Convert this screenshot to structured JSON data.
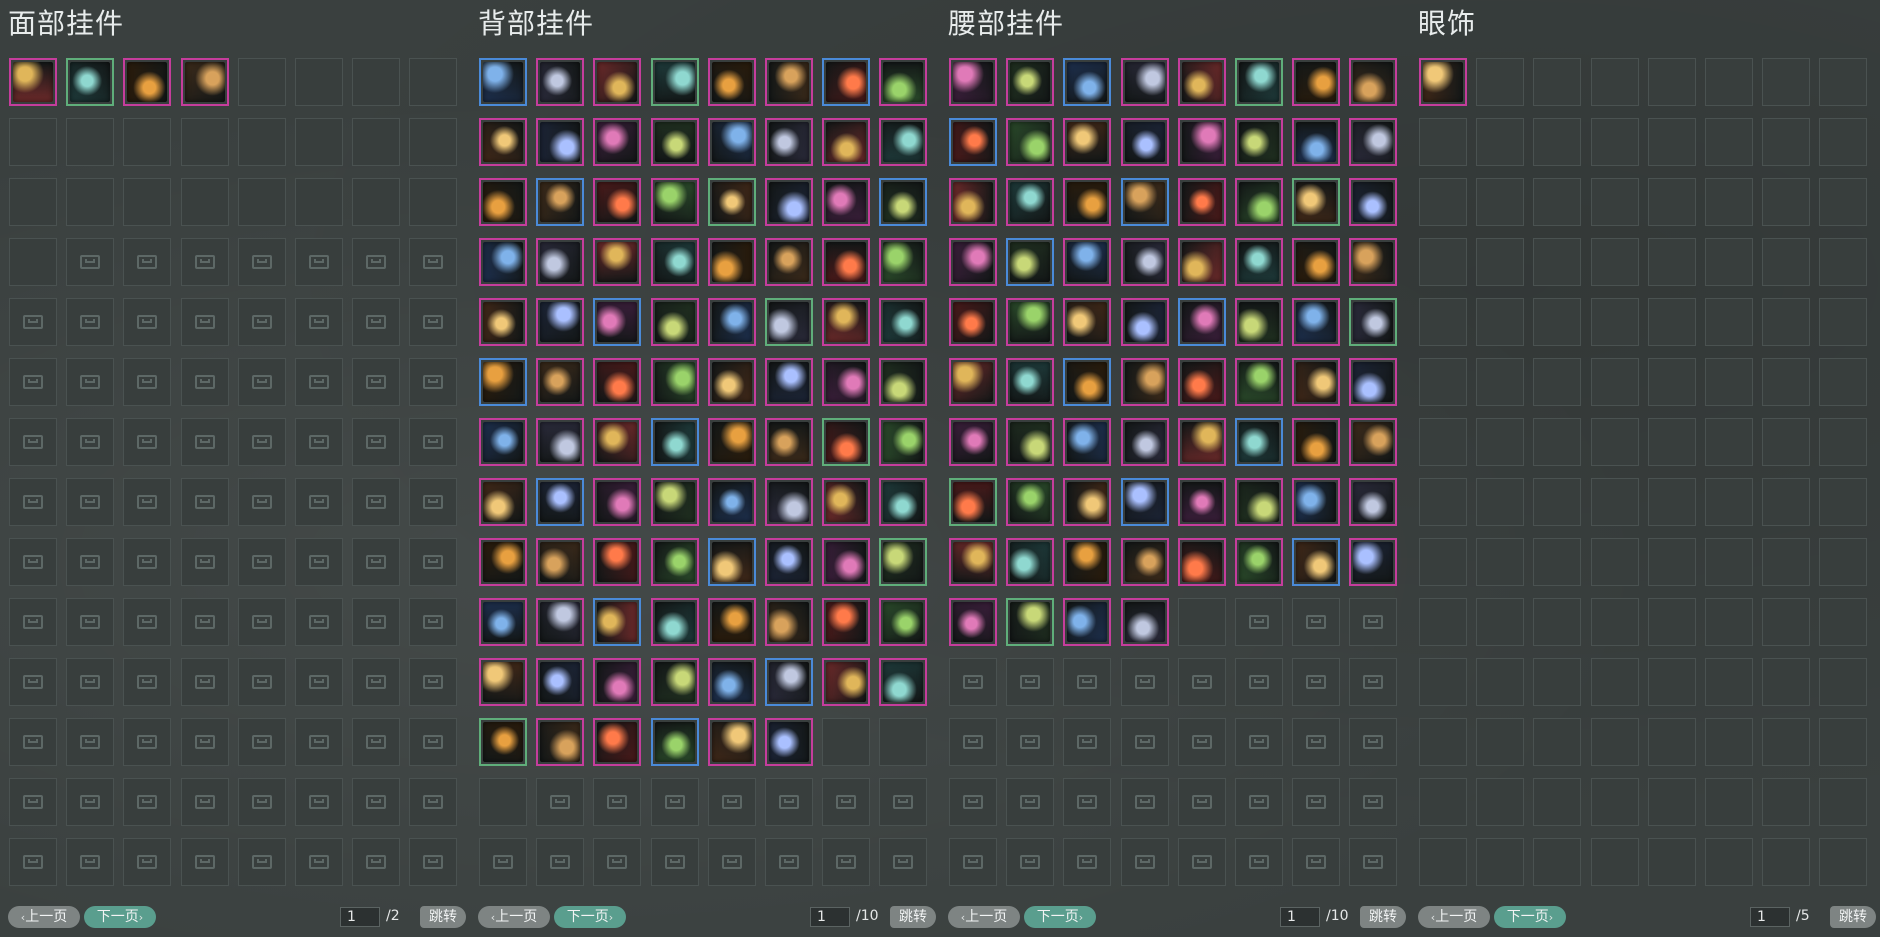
{
  "panels": [
    {
      "title": "面部挂件",
      "filled": 4,
      "plain_until": 25,
      "current_page": "1",
      "total_pages": "/2",
      "prev_label": "上一页",
      "next_label": "下一页",
      "jump_label": "跳转"
    },
    {
      "title": "背部挂件",
      "filled": 94,
      "plain_until": 97,
      "current_page": "1",
      "total_pages": "/10",
      "prev_label": "上一页",
      "next_label": "下一页",
      "jump_label": "跳转"
    },
    {
      "title": "腰部挂件",
      "filled": 76,
      "plain_until": 77,
      "current_page": "1",
      "total_pages": "/10",
      "prev_label": "上一页",
      "next_label": "下一页",
      "jump_label": "跳转"
    },
    {
      "title": "眼饰",
      "filled": 1,
      "plain_until": 112,
      "current_page": "1",
      "total_pages": "/5",
      "prev_label": "上一页",
      "next_label": "下一页",
      "jump_label": "跳转"
    }
  ],
  "colors": {
    "rare_border": "#c53d9c",
    "blue_border": "#4a8ad8",
    "green_border": "#5fae7a",
    "next_button": "#5a9e8e",
    "prev_button": "#7e8483"
  }
}
